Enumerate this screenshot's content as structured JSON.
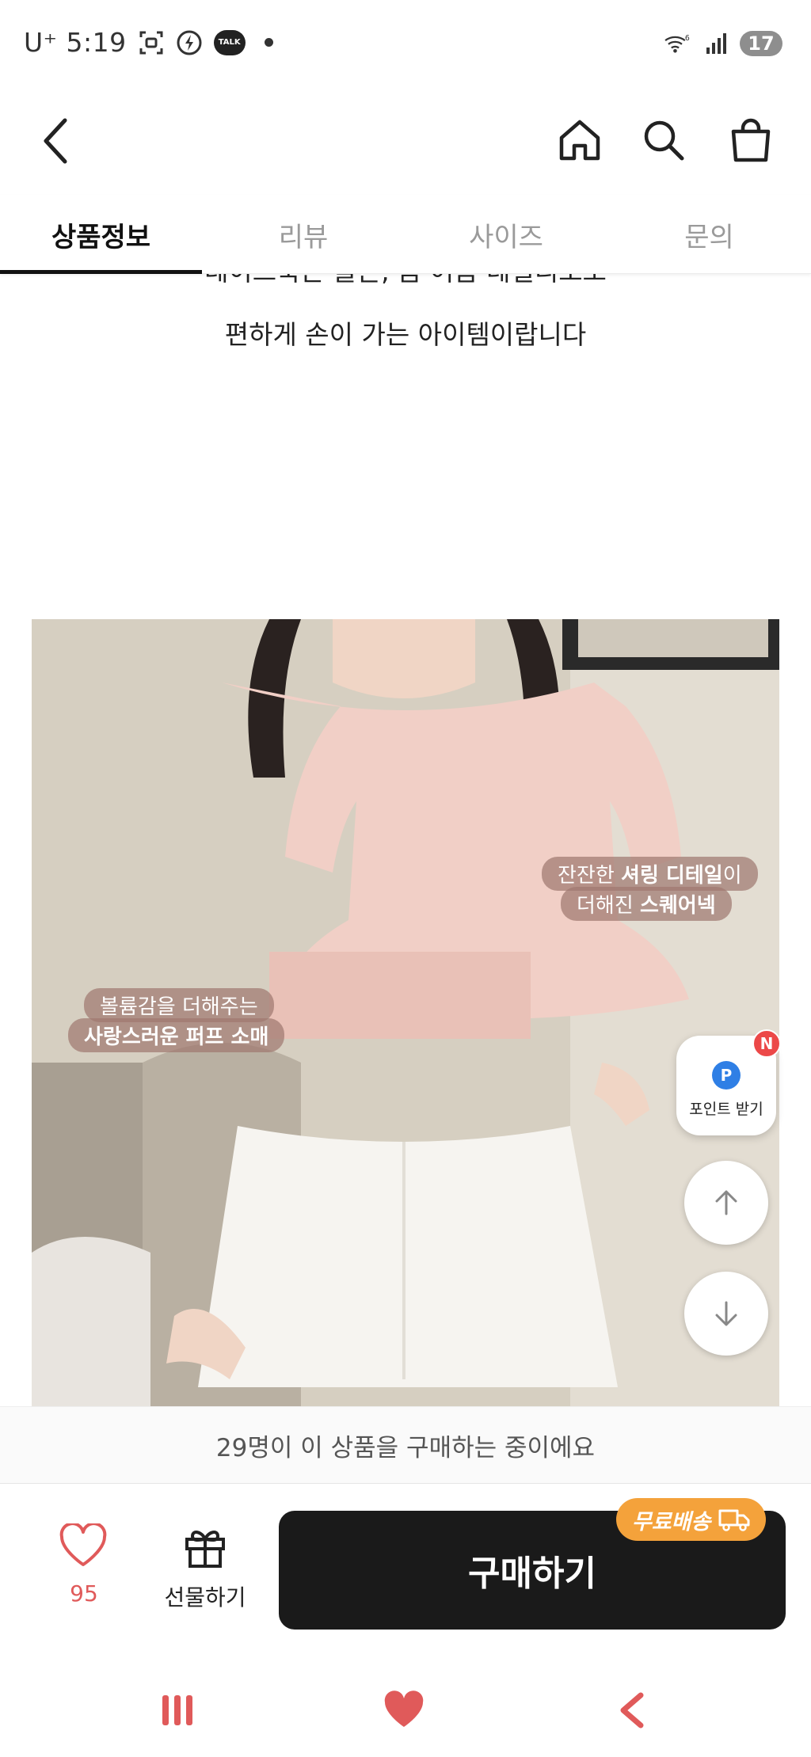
{
  "status_bar": {
    "carrier": "U⁺ 5:19",
    "talk_label": "TALK",
    "wifi_label": "6",
    "battery": "17"
  },
  "header": {
    "back_icon": "chevron-left-icon",
    "home_icon": "home-icon",
    "search_icon": "search-icon",
    "cart_icon": "shopping-bag-icon"
  },
  "tabs": [
    {
      "label": "상품정보",
      "active": true
    },
    {
      "label": "리뷰",
      "active": false
    },
    {
      "label": "사이즈",
      "active": false
    },
    {
      "label": "문의",
      "active": false
    }
  ],
  "content": {
    "desc_partial": "데이트룩은 물론, 봄 여름 데일리로도",
    "desc_line": "편하게 손이 가는 아이템이랍니다",
    "captions": {
      "shirring_pre": "잔잔한 ",
      "shirring_bold": "셔링 디테일",
      "shirring_post": "이",
      "square_pre": "더해진 ",
      "square_bold": "스퀘어넥",
      "puff_line1": "볼륨감을 더해주는",
      "puff_line2": "사랑스러운 퍼프 소매"
    }
  },
  "floating": {
    "badge": "N",
    "point_circle": "P",
    "point_label": "포인트 받기",
    "up_icon": "arrow-up-icon",
    "down_icon": "arrow-down-icon"
  },
  "buying_banner": "29명이 이 상품을 구매하는 중이에요",
  "action_bar": {
    "like_count": "95",
    "gift_label": "선물하기",
    "buy_label": "구매하기",
    "free_shipping": "무료배송"
  },
  "colors": {
    "accent_red": "#e05a5a",
    "buy_button": "#1a1a1a",
    "free_shipping": "#f4a23b",
    "point_blue": "#2f7fe5"
  }
}
